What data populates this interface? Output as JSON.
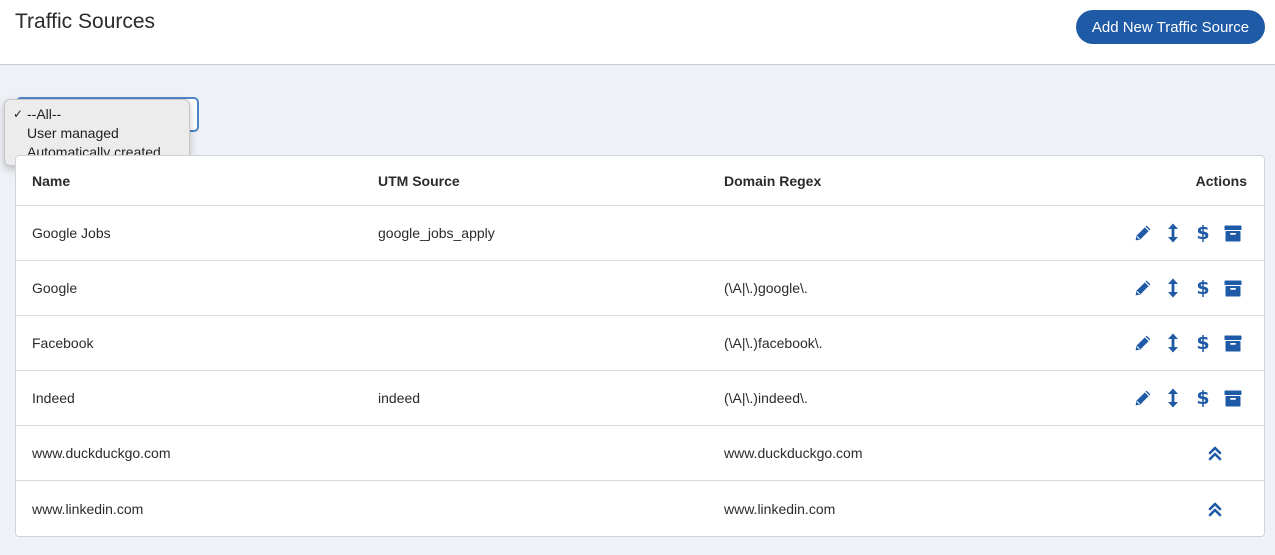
{
  "header": {
    "title": "Traffic Sources",
    "add_button_label": "Add New Traffic Source"
  },
  "filter": {
    "options": [
      {
        "label": "--All--",
        "selected": true
      },
      {
        "label": "User managed",
        "selected": false
      },
      {
        "label": "Automatically created",
        "selected": false
      }
    ]
  },
  "table": {
    "columns": {
      "name": "Name",
      "utm": "UTM Source",
      "domain": "Domain Regex",
      "actions": "Actions"
    },
    "rows": [
      {
        "name": "Google Jobs",
        "utm": "google_jobs_apply",
        "domain": "",
        "type": "managed"
      },
      {
        "name": "Google",
        "utm": "",
        "domain": "(\\A|\\.)google\\.",
        "type": "managed"
      },
      {
        "name": "Facebook",
        "utm": "",
        "domain": "(\\A|\\.)facebook\\.",
        "type": "managed"
      },
      {
        "name": "Indeed",
        "utm": "indeed",
        "domain": "(\\A|\\.)indeed\\.",
        "type": "managed"
      },
      {
        "name": "www.duckduckgo.com",
        "utm": "",
        "domain": "www.duckduckgo.com",
        "type": "auto"
      },
      {
        "name": "www.linkedin.com",
        "utm": "",
        "domain": "www.linkedin.com",
        "type": "auto"
      }
    ]
  },
  "icons": {
    "edit": "pencil-icon",
    "reorder": "arrows-vertical-icon",
    "cost": "dollar-icon",
    "archive": "archive-box-icon",
    "promote": "double-chevron-up-icon",
    "check": "✓",
    "dollar_glyph": "$"
  },
  "colors": {
    "accent": "#1f5aa6",
    "page_bg": "#eef1f5"
  }
}
